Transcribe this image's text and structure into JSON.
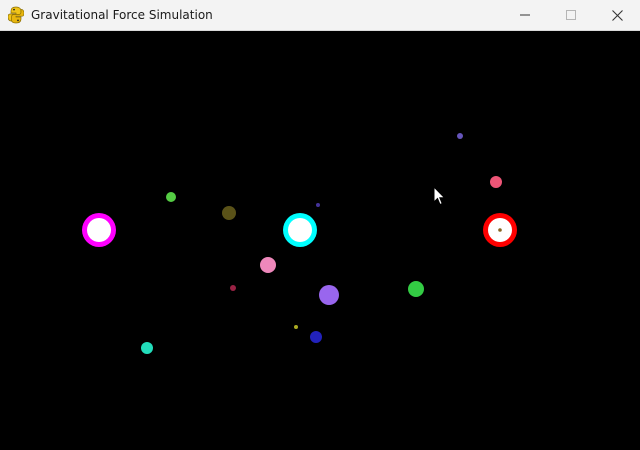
{
  "window": {
    "title": "Gravitational Force Simulation",
    "icon": "pygame-snake-icon",
    "controls": [
      "minimize-icon",
      "maximize-icon",
      "close-icon"
    ]
  },
  "simulation": {
    "background": "#000000",
    "bodies": [
      {
        "name": "magenta-ring-body",
        "kind": "ring",
        "color": "#ff00ff",
        "core": "#ffffff"
      },
      {
        "name": "cyan-ring-body",
        "kind": "ring",
        "color": "#00ffff",
        "core": "#ffffff"
      },
      {
        "name": "red-ring-body",
        "kind": "ring",
        "color": "#ff0000",
        "core": "#ffffff"
      },
      {
        "name": "green-particle",
        "kind": "dot",
        "color": "#55cc44"
      },
      {
        "name": "olive-particle",
        "kind": "dot",
        "color": "#5a5218"
      },
      {
        "name": "pink-particle",
        "kind": "dot",
        "color": "#ee88bb"
      },
      {
        "name": "purple-particle",
        "kind": "dot",
        "color": "#9966ee"
      },
      {
        "name": "green-large-particle",
        "kind": "dot",
        "color": "#33cc44"
      },
      {
        "name": "teal-particle",
        "kind": "dot",
        "color": "#22ddbb"
      },
      {
        "name": "navy-particle",
        "kind": "dot",
        "color": "#2222bb"
      },
      {
        "name": "rose-particle",
        "kind": "dot",
        "color": "#ee5577"
      },
      {
        "name": "violet-tiny-particle",
        "kind": "dot",
        "color": "#6655bb"
      },
      {
        "name": "indigo-tiny-particle",
        "kind": "dot",
        "color": "#443399"
      },
      {
        "name": "maroon-tiny-particle",
        "kind": "dot",
        "color": "#992244"
      },
      {
        "name": "yellow-tiny-particle",
        "kind": "dot",
        "color": "#aaaa22"
      },
      {
        "name": "brown-tiny-particle",
        "kind": "dot",
        "color": "#886622"
      }
    ]
  }
}
